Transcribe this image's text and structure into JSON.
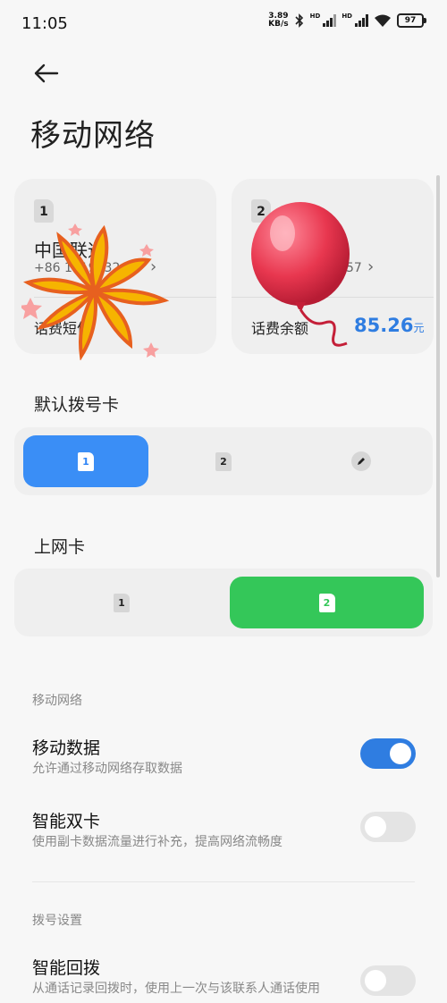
{
  "status_bar": {
    "time": "11:05",
    "net_speed": "3.89",
    "net_speed_unit": "KB/s",
    "hd1": "HD",
    "hd2": "HD",
    "battery": "97"
  },
  "header": {
    "title": "移动网络",
    "back_icon": "arrow-left-icon"
  },
  "sim_cards": [
    {
      "slot": "1",
      "carrier": "中国联通",
      "phone": "+86 1019732",
      "bottom_label": "话费短信",
      "sticker": "fireworks"
    },
    {
      "slot": "2",
      "phone_suffix": "57",
      "bottom_label": "话费余额",
      "balance": "85.26",
      "balance_unit": "元",
      "sticker": "balloon"
    }
  ],
  "default_dial": {
    "title": "默认拨号卡",
    "options": [
      "1",
      "2"
    ],
    "edit_icon": "pencil-icon",
    "selected": "1"
  },
  "data_card": {
    "title": "上网卡",
    "options": [
      "1",
      "2"
    ],
    "selected": "2"
  },
  "mobile_network": {
    "group_label": "移动网络",
    "items": [
      {
        "title": "移动数据",
        "desc": "允许通过移动网络存取数据",
        "enabled": true
      },
      {
        "title": "智能双卡",
        "desc": "使用副卡数据流量进行补充，提高网络流畅度",
        "enabled": false
      }
    ]
  },
  "dial_settings": {
    "group_label": "拨号设置",
    "items": [
      {
        "title": "智能回拨",
        "desc": "从通话记录回拨时，使用上一次与该联系人通话使用",
        "enabled": false
      }
    ]
  },
  "colors": {
    "accent_blue": "#2f7de1",
    "selected_blue": "#3a8ef6",
    "selected_green": "#34c759",
    "background": "#f7f7f7"
  }
}
